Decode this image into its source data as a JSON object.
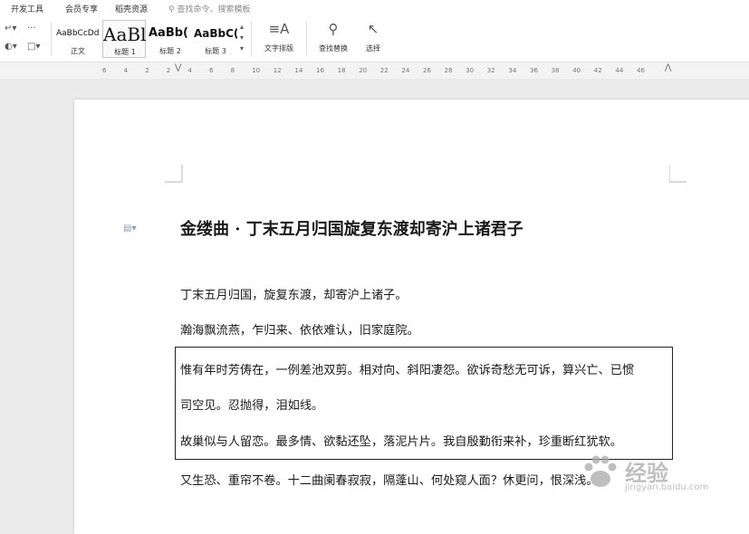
{
  "menubar": {
    "items": [
      "开发工具",
      "会员专享",
      "稻壳资源"
    ],
    "search_placeholder": "查找命令、搜索模板"
  },
  "ribbon": {
    "styles": [
      {
        "preview": "AaBbCcDd",
        "caption": "正文"
      },
      {
        "preview": "AaBl",
        "caption": "标题 1"
      },
      {
        "preview": "AaBb(",
        "caption": "标题 2"
      },
      {
        "preview": "AaBbC(",
        "caption": "标题 3"
      }
    ],
    "text_layout_label": "文字排版",
    "find_replace_label": "查找替换",
    "select_label": "选择"
  },
  "ruler": {
    "ticks": [
      "6",
      "4",
      "2",
      "2",
      "4",
      "6",
      "8",
      "10",
      "12",
      "14",
      "16",
      "18",
      "20",
      "22",
      "24",
      "26",
      "28",
      "30",
      "32",
      "34",
      "36",
      "38",
      "40",
      "42",
      "44",
      "46"
    ]
  },
  "document": {
    "title": "金缕曲 · 丁末五月归国旋复东渡却寄沪上诸君子",
    "paragraphs": [
      "丁末五月归国，旋复东渡，却寄沪上诸子。",
      "瀚海飘流燕，乍归来、依依难认，旧家庭院。",
      "惟有年时芳俦在，一例差池双剪。相对向、斜阳凄怨。欲诉奇愁无可诉，算兴亡、已惯",
      "司空见。忍抛得，泪如线。",
      "故巢似与人留恋。最多情、欲黏还坠，落泥片片。我自殷勤衔来补，珍重断红犹软。",
      "又生恐、重帘不卷。十二曲阑春寂寂，隔蓬山、何处窥人面？休更问，恨深浅。"
    ]
  },
  "watermark": {
    "text": "经验",
    "url": "jingyan.baidu.com"
  }
}
